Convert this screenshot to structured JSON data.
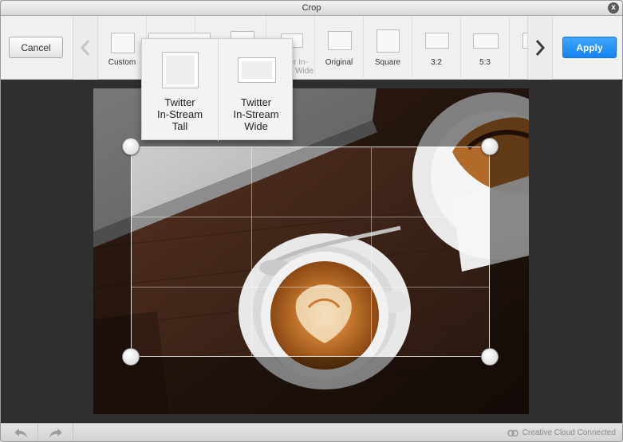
{
  "window": {
    "title": "Crop",
    "close_label": "x"
  },
  "toolbar": {
    "cancel_label": "Cancel",
    "apply_label": "Apply",
    "presets": [
      {
        "label": "Custom"
      },
      {
        "label": ""
      },
      {
        "label": ""
      },
      {
        "label": "Twitter In-Stream Wide"
      },
      {
        "label": "Original"
      },
      {
        "label": "Square"
      },
      {
        "label": "3:2"
      },
      {
        "label": "5:3"
      }
    ]
  },
  "popup": {
    "items": [
      {
        "line1": "Twitter",
        "line2": "In-Stream",
        "line3": "Tall"
      },
      {
        "line1": "Twitter",
        "line2": "In-Stream",
        "line3": "Wide"
      }
    ]
  },
  "status": {
    "cloud_label": "Creative Cloud Connected"
  },
  "colors": {
    "accent": "#1a8cff",
    "canvas": "#2f2f2f",
    "toolbar": "#f0f0f0"
  },
  "icons": {
    "prev": "chevron-left-icon",
    "next": "chevron-right-icon",
    "undo": "undo-arrow-icon",
    "redo": "redo-arrow-icon",
    "cloud": "creative-cloud-icon",
    "close": "close-icon"
  }
}
